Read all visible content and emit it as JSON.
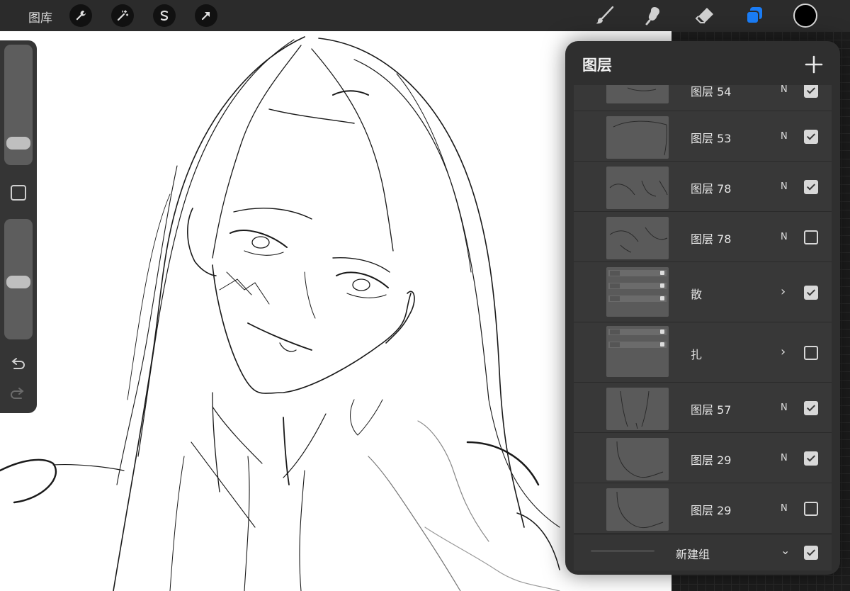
{
  "topbar": {
    "gallery_label": "图库",
    "left_tools": [
      "wrench-icon",
      "magic-wand-icon",
      "selection-icon",
      "transform-arrow-icon"
    ],
    "right_tools": [
      "brush-icon",
      "smudge-icon",
      "eraser-icon",
      "layers-icon"
    ],
    "active_tool_color": "#1a7cf5",
    "current_color": "#000000"
  },
  "layers_panel": {
    "title": "图层",
    "layers": [
      {
        "name": "图层 54",
        "blend": "N",
        "visible": true,
        "kind": "layer"
      },
      {
        "name": "图层 53",
        "blend": "N",
        "visible": true,
        "kind": "layer"
      },
      {
        "name": "图层 78",
        "blend": "N",
        "visible": true,
        "kind": "layer"
      },
      {
        "name": "图层 78",
        "blend": "N",
        "visible": false,
        "kind": "layer"
      },
      {
        "name": "散",
        "blend": "›",
        "visible": true,
        "kind": "group"
      },
      {
        "name": "扎",
        "blend": "›",
        "visible": false,
        "kind": "group"
      },
      {
        "name": "图层 57",
        "blend": "N",
        "visible": true,
        "kind": "layer"
      },
      {
        "name": "图层 29",
        "blend": "N",
        "visible": true,
        "kind": "layer"
      },
      {
        "name": "图层 29",
        "blend": "N",
        "visible": false,
        "kind": "layer"
      }
    ],
    "new_group": {
      "name": "新建组",
      "chevron": "⌄",
      "visible": true
    }
  }
}
